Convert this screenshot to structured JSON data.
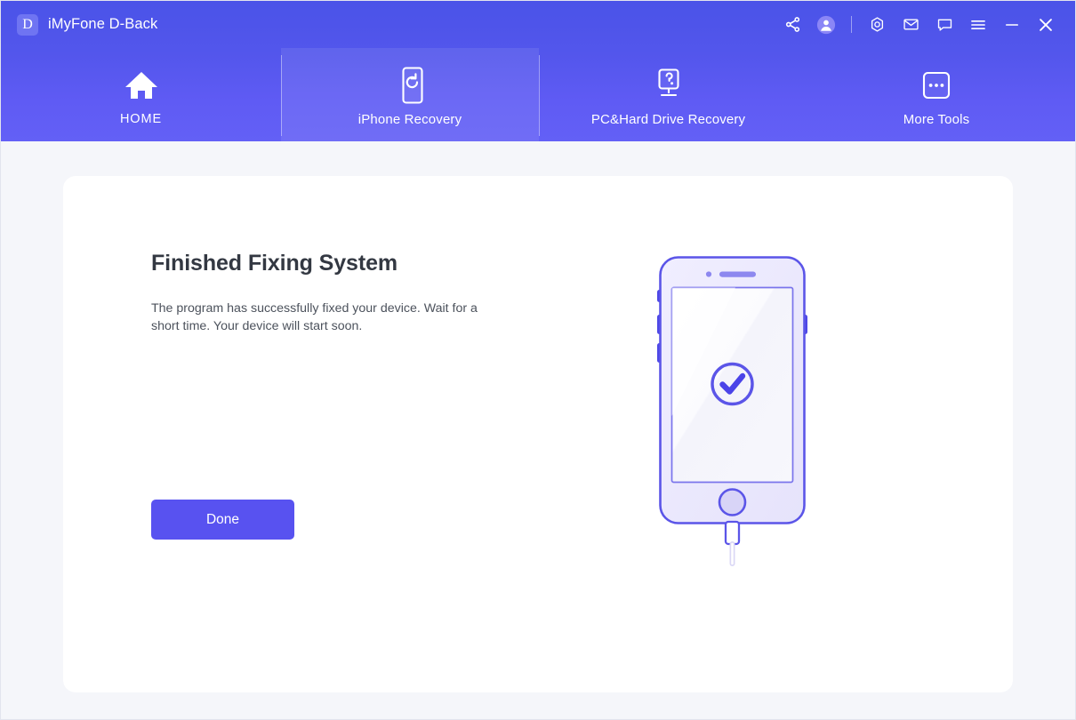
{
  "window": {
    "app_title": "iMyFone D-Back",
    "logo_letter": "D"
  },
  "titlebar": {
    "actions": [
      {
        "name": "share-icon",
        "label": "Share"
      },
      {
        "name": "avatar-icon",
        "label": "Account"
      },
      {
        "name": "support-icon",
        "label": "Support"
      },
      {
        "name": "mail-icon",
        "label": "Mail"
      },
      {
        "name": "chat-icon",
        "label": "Feedback"
      },
      {
        "name": "menu-icon",
        "label": "Menu"
      },
      {
        "name": "minimize-icon",
        "label": "Minimize"
      },
      {
        "name": "close-icon",
        "label": "Close"
      }
    ]
  },
  "nav": {
    "tabs": [
      {
        "label": "HOME",
        "icon": "home-icon",
        "active": false
      },
      {
        "label": "iPhone Recovery",
        "icon": "phone-refresh-icon",
        "active": true
      },
      {
        "label": "PC&Hard Drive Recovery",
        "icon": "monitor-icon",
        "active": false
      },
      {
        "label": "More Tools",
        "icon": "more-dots-icon",
        "active": false
      }
    ]
  },
  "main": {
    "headline": "Finished Fixing System",
    "description": "The program has successfully fixed your device. Wait for a short time. Your device will start soon.",
    "done_label": "Done",
    "illustration": "iphone-with-check-and-cable"
  },
  "colors": {
    "header_top": "#4a53e8",
    "header_bottom": "#6360f6",
    "accent": "#5852f0",
    "phone_outline": "#5b55e8",
    "phone_body": "#eceaff",
    "page_bg": "#f5f6fa",
    "card_bg": "#ffffff",
    "headline_text": "#333842",
    "body_text": "#4c525c"
  }
}
